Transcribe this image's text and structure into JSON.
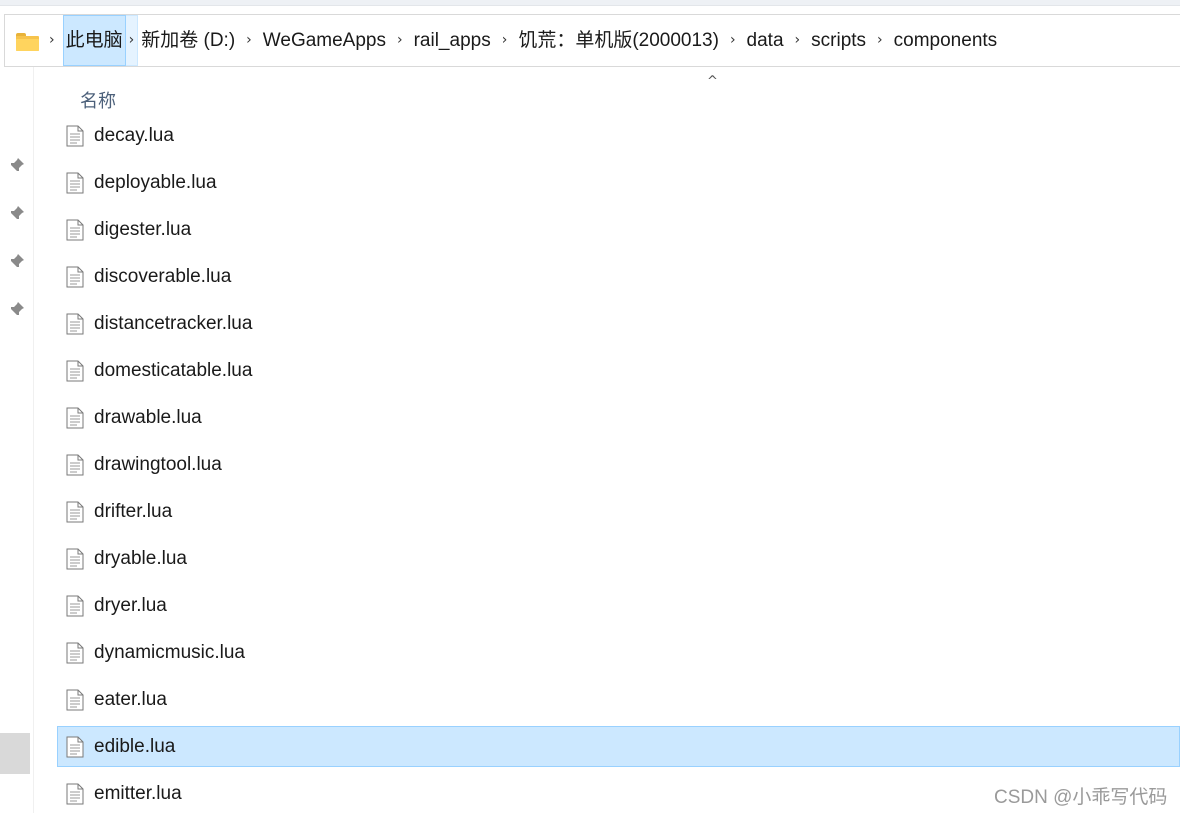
{
  "addressbar": {
    "icon": "folder-icon",
    "breadcrumbs": [
      "此电脑",
      "新加卷 (D:)",
      "WeGameApps",
      "rail_apps",
      "饥荒：单机版(2000013)",
      "data",
      "scripts",
      "components"
    ]
  },
  "column_header": {
    "name": "名称",
    "sort_icon": "chevron-up-icon",
    "sort_glyph": "^"
  },
  "quick_access_pins": [
    "pin-icon",
    "pin-icon",
    "pin-icon",
    "pin-icon"
  ],
  "files": [
    {
      "name": "decay.lua"
    },
    {
      "name": "deployable.lua"
    },
    {
      "name": "digester.lua"
    },
    {
      "name": "discoverable.lua"
    },
    {
      "name": "distancetracker.lua"
    },
    {
      "name": "domesticatable.lua"
    },
    {
      "name": "drawable.lua"
    },
    {
      "name": "drawingtool.lua"
    },
    {
      "name": "drifter.lua"
    },
    {
      "name": "dryable.lua"
    },
    {
      "name": "dryer.lua"
    },
    {
      "name": "dynamicmusic.lua"
    },
    {
      "name": "eater.lua"
    },
    {
      "name": "edible.lua",
      "selected": true
    },
    {
      "name": "emitter.lua"
    }
  ],
  "watermark": "CSDN @小乖写代码",
  "colors": {
    "selection": "#cce8ff",
    "selection_border": "#99d1ff",
    "header_text": "#4c607a"
  }
}
